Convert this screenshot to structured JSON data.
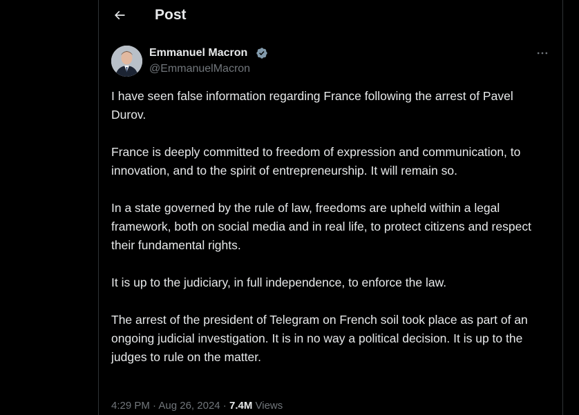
{
  "header": {
    "title": "Post"
  },
  "author": {
    "name": "Emmanuel Macron",
    "handle": "@EmmanuelMacron",
    "verified": true
  },
  "post": {
    "paragraphs": [
      "I have seen false information regarding France following the arrest of Pavel Durov.",
      "France is deeply committed to freedom of expression and communication, to innovation, and to the spirit of entrepreneurship. It will remain so.",
      "In a state governed by the rule of law, freedoms are upheld within a legal framework, both on social media and in real life, to protect citizens and respect their fundamental rights.",
      "It is up to the judiciary, in full independence, to enforce the law.",
      "The arrest of the president of Telegram on French soil took place as part of an ongoing judicial investigation. It is in no way a political decision. It is up to the judges to rule on the matter."
    ],
    "time": "4:29 PM",
    "separator1": " · ",
    "date": "Aug 26, 2024",
    "separator2": " · ",
    "views_count": "7.4M",
    "views_label": " Views"
  },
  "colors": {
    "background": "#000000",
    "text_primary": "#e7e9ea",
    "text_secondary": "#71767b",
    "verified_badge": "#829aab",
    "border": "#2f3336"
  },
  "icons": {
    "back": "arrow-left-icon",
    "verified": "verified-badge-icon",
    "more": "more-horizontal-icon"
  }
}
